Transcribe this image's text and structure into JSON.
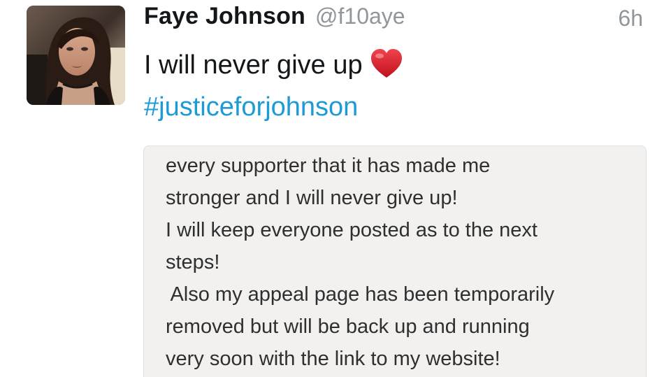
{
  "tweet": {
    "author": {
      "display_name": "Faye Johnson",
      "handle": "@f10aye"
    },
    "timestamp": "6h",
    "text": "I will never give up",
    "emoji_icon": "red-heart-icon",
    "hashtag": "#justiceforjohnson",
    "colors": {
      "hashtag": "#1d9bd8",
      "muted": "#8f969c",
      "heart": "#d9202b"
    },
    "media_text_lines": [
      "every supporter that it has made me",
      "stronger and I will never give up!",
      "I will keep everyone posted as to the next",
      "steps!",
      " Also my appeal page has been temporarily",
      "removed but will be back up and running",
      "very soon with the link to my website!"
    ]
  }
}
